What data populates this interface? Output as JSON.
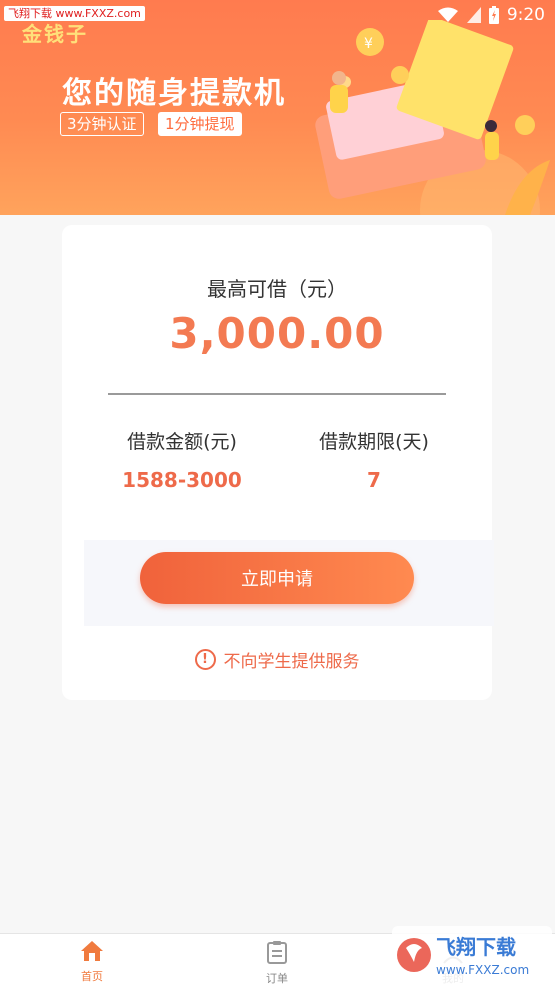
{
  "status_bar": {
    "watermark": "飞翔下载 www.FXXZ.com",
    "time": "9:20"
  },
  "banner": {
    "brand": "金钱子",
    "slogan": "您的随身提款机",
    "tag1": "3分钟认证",
    "tag2": "1分钟提现"
  },
  "loan_card": {
    "max_label": "最高可借（元）",
    "max_amount": "3,000.00",
    "amount_label": "借款金额(元)",
    "amount_range": "1588-3000",
    "term_label": "借款期限(天)",
    "term_value": "7",
    "apply_button": "立即申请",
    "notice": "不向学生提供服务"
  },
  "tabbar": {
    "tabs": [
      {
        "label": "首页",
        "icon": "home-icon",
        "active": true
      },
      {
        "label": "订单",
        "icon": "orders-icon",
        "active": false
      },
      {
        "label": "我的",
        "icon": "profile-icon",
        "active": false
      }
    ]
  },
  "watermark_bottom": {
    "title": "飞翔下载",
    "url": "www.FXXZ.com"
  },
  "colors": {
    "accent": "#f07a3e",
    "amount": "#f37a52",
    "banner": "#ff7b4f"
  }
}
